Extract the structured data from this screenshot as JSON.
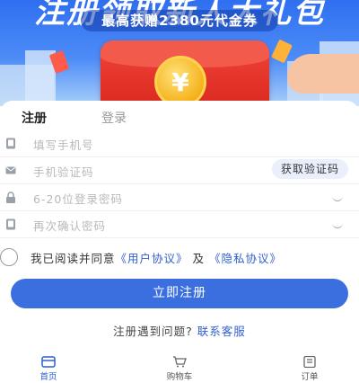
{
  "banner": {
    "headline": "注册领取新人大礼包",
    "subtitle": "最高获赠2380元代金券",
    "coin_symbol": "¥"
  },
  "tabs": [
    {
      "label": "注册",
      "active": true
    },
    {
      "label": "登录",
      "active": false
    }
  ],
  "form": {
    "phone_placeholder": "填写手机号",
    "code_placeholder": "手机验证码",
    "code_button": "获取验证码",
    "password_placeholder": "6-20位登录密码",
    "confirm_placeholder": "再次确认密码"
  },
  "agreement": {
    "prefix": "我已阅读并同意",
    "user_agreement": "《用户协议》",
    "and": "及",
    "privacy_agreement": "《隐私协议》"
  },
  "submit_label": "立即注册",
  "help": {
    "text": "注册遇到问题?",
    "link": "联系客服"
  },
  "nav": [
    {
      "label": "首页",
      "icon": "home-icon",
      "active": true
    },
    {
      "label": "购物车",
      "icon": "cart-icon",
      "active": false
    },
    {
      "label": "订单",
      "icon": "order-icon",
      "active": false
    }
  ],
  "colors": {
    "accent": "#3b6fe0",
    "link": "#2f5fd0",
    "banner_top": "#2f6ff0"
  }
}
